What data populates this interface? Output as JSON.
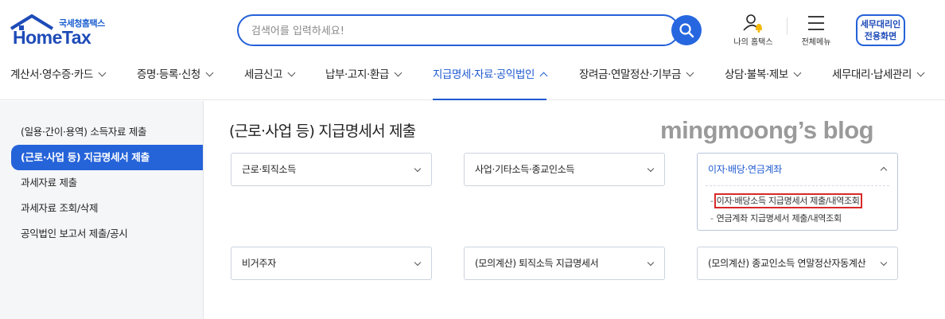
{
  "header": {
    "logo_sub": "국세청홈택스",
    "logo_main": "HomeTax",
    "search_placeholder": "검색어를 입력하세요!",
    "my_hometax": "나의 홈택스",
    "full_menu": "전체메뉴",
    "agent_line1": "세무대리인",
    "agent_line2": "전용화면"
  },
  "gnb": {
    "items": [
      {
        "label": "계산서·영수증·카드"
      },
      {
        "label": "증명·등록·신청"
      },
      {
        "label": "세금신고"
      },
      {
        "label": "납부·고지·환급"
      },
      {
        "label": "지급명세·자료·공익법인",
        "active": true
      },
      {
        "label": "장려금·연말정산·기부금"
      },
      {
        "label": "상담·불복·제보"
      },
      {
        "label": "세무대리·납세관리"
      }
    ]
  },
  "sidebar": {
    "items": [
      {
        "label": "(일용·간이·용역) 소득자료 제출"
      },
      {
        "label": "(근로·사업 등) 지급명세서 제출",
        "active": true
      },
      {
        "label": "과세자료 제출"
      },
      {
        "label": "과세자료 조회/삭제"
      },
      {
        "label": "공익법인 보고서 제출/공시"
      }
    ]
  },
  "main": {
    "title": "(근로·사업 등) 지급명세서 제출",
    "watermark": "mingmoong’s blog",
    "boxes": [
      {
        "label": "근로·퇴직소득"
      },
      {
        "label": "사업·기타소득·종교인소득"
      },
      {
        "label": "이자·배당·연금계좌",
        "expanded": true,
        "subitems": [
          {
            "label": "이자·배당소득 지급명세서 제출/내역조회",
            "highlighted": true
          },
          {
            "label": "연금계좌 지급명세서 제출/내역조회"
          }
        ]
      },
      {
        "label": "비거주자"
      },
      {
        "label": "(모의계산) 퇴직소득 지급명세서"
      },
      {
        "label": "(모의계산) 종교인소득 연말정산자동계산"
      }
    ]
  },
  "colors": {
    "brand_blue": "#2563d9",
    "highlight_red": "#d72a2a"
  }
}
